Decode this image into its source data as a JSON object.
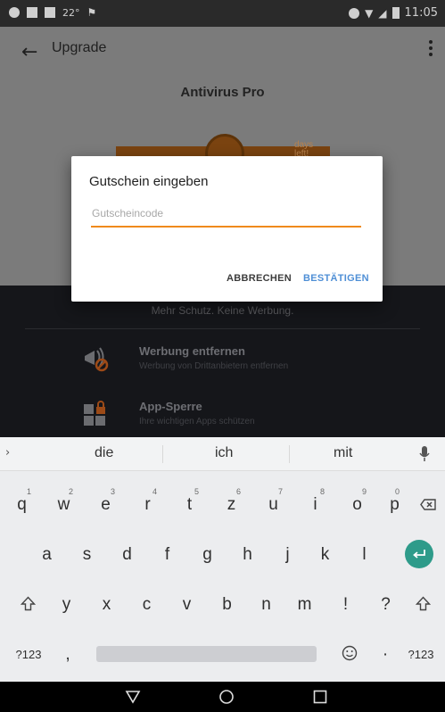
{
  "status_bar": {
    "temperature": "22°",
    "time": "11:05"
  },
  "app_bar": {
    "title": "Upgrade"
  },
  "product": {
    "name": "Antivirus Pro",
    "ribbon_text": "days left!",
    "subtitle": "Mehr Schutz. Keine Werbung."
  },
  "features": [
    {
      "title": "Werbung entfernen",
      "description": "Werbung von Drittanbietern entfernen",
      "icon": "megaphone-blocked-icon"
    },
    {
      "title": "App-Sperre",
      "description": "Ihre wichtigen Apps schützen",
      "icon": "app-lock-icon"
    }
  ],
  "dialog": {
    "title": "Gutschein eingeben",
    "input_placeholder": "Gutscheincode",
    "input_value": "",
    "cancel_label": "ABBRECHEN",
    "confirm_label": "BESTÄTIGEN"
  },
  "keyboard": {
    "suggestions": [
      "die",
      "ich",
      "mit"
    ],
    "row1": [
      {
        "key": "q",
        "hint": "1"
      },
      {
        "key": "w",
        "hint": "2"
      },
      {
        "key": "e",
        "hint": "3"
      },
      {
        "key": "r",
        "hint": "4"
      },
      {
        "key": "t",
        "hint": "5"
      },
      {
        "key": "z",
        "hint": "6"
      },
      {
        "key": "u",
        "hint": "7"
      },
      {
        "key": "i",
        "hint": "8"
      },
      {
        "key": "o",
        "hint": "9"
      },
      {
        "key": "p",
        "hint": "0"
      }
    ],
    "row2": [
      "a",
      "s",
      "d",
      "f",
      "g",
      "h",
      "j",
      "k",
      "l"
    ],
    "row3": [
      "y",
      "x",
      "c",
      "v",
      "b",
      "n",
      "m",
      "!",
      "?"
    ],
    "row4": {
      "symbols_label": "?123",
      "comma": ",",
      "period": "·",
      "symbols_label_right": "?123"
    }
  },
  "colors": {
    "accent_orange": "#f08a1c",
    "confirm_blue": "#4f8fd6",
    "enter_teal": "#2e9b8a"
  }
}
